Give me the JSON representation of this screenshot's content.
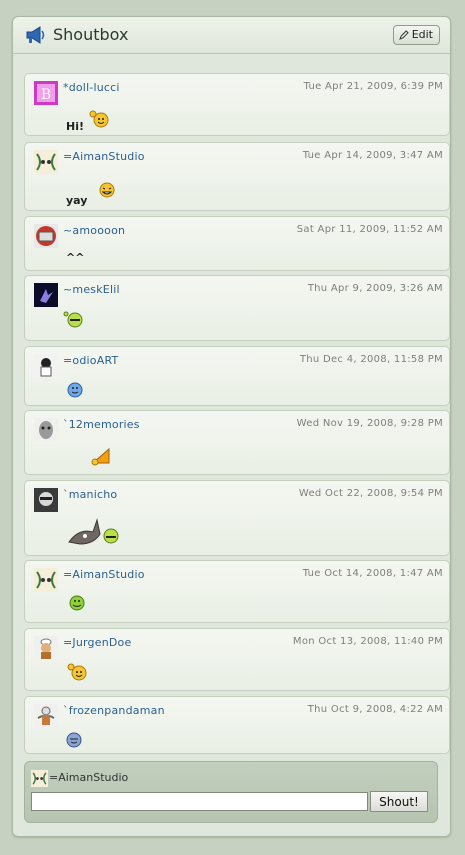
{
  "header": {
    "title": "Shoutbox",
    "edit_label": "Edit"
  },
  "shouts": [
    {
      "author": "*doll-lucci",
      "date": "Tue Apr 21, 2009, 6:39 PM",
      "message": "Hi!"
    },
    {
      "author": "=AimanStudio",
      "date": "Tue Apr 14, 2009, 3:47 AM",
      "message": "yay"
    },
    {
      "author": "~amoooon",
      "date": "Sat Apr 11, 2009, 11:52 AM",
      "message": "^^"
    },
    {
      "author": "~meskElil",
      "date": "Thu Apr 9, 2009, 3:26 AM",
      "message": ""
    },
    {
      "author": "=odioART",
      "date": "Thu Dec 4, 2008, 11:58 PM",
      "message": ""
    },
    {
      "author": "`12memories",
      "date": "Wed Nov 19, 2008, 9:28 PM",
      "message": ""
    },
    {
      "author": "`manicho",
      "date": "Wed Oct 22, 2008, 9:54 PM",
      "message": ""
    },
    {
      "author": "=AimanStudio",
      "date": "Tue Oct 14, 2008, 1:47 AM",
      "message": ""
    },
    {
      "author": "=JurgenDoe",
      "date": "Mon Oct 13, 2008, 11:40 PM",
      "message": ""
    },
    {
      "author": "`frozenpandaman",
      "date": "Thu Oct 9, 2008, 4:22 AM",
      "message": ""
    }
  ],
  "compose": {
    "user": "=AimanStudio",
    "input_value": "",
    "shout_label": "Shout!"
  },
  "icons": {
    "header": "megaphone-icon",
    "edit": "pencil-icon",
    "emoticons": [
      "waving-smiley-icon",
      "laughing-smiley-icon",
      "",
      "grinning-smiley-icon",
      "blue-smiley-icon",
      "horn-emoticon-icon",
      "donkey-and-grin-emoticon-icon",
      "green-smiley-icon",
      "waving-smiley-icon",
      "blue-smiley-icon"
    ]
  },
  "colors": {
    "author_link": "#2a5f8f",
    "panel_bg": "#dfe6db",
    "page_bg": "#c7d1c1"
  }
}
